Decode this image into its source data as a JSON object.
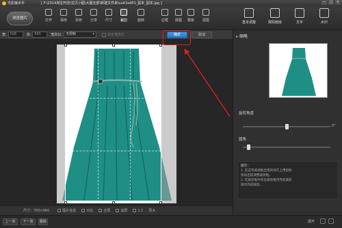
{
  "title": {
    "app_name": "光影魔术手",
    "document": "[ F:\\2014淘宝开店\\宝贝小图\\大图全部\\新建文件夹\\suit1ed01_副本_副本.jpg ]",
    "window_controls": [
      "—",
      "□",
      "×"
    ]
  },
  "toolbar": {
    "open_label": "浏览图片",
    "tools": [
      {
        "label": "打开",
        "icon": "folder-icon"
      },
      {
        "label": "保存",
        "icon": "save-icon"
      },
      {
        "label": "另存",
        "icon": "save-as-icon"
      },
      {
        "label": "分享",
        "icon": "share-icon"
      },
      {
        "label": "尺寸",
        "icon": "resize-icon"
      },
      {
        "label": "裁剪",
        "icon": "crop-icon",
        "active": true
      },
      {
        "label": "旋转",
        "icon": "rotate-icon"
      },
      {
        "label": "边框",
        "icon": "frame-icon"
      },
      {
        "label": "拼图",
        "icon": "collage-icon"
      },
      {
        "label": "模板",
        "icon": "template-icon"
      },
      {
        "label": "抠图",
        "icon": "cutout-icon"
      }
    ],
    "big_tools": [
      {
        "label": "基本调整",
        "icon": "adjust-icon"
      },
      {
        "label": "数码暗房",
        "icon": "camera-icon"
      },
      {
        "label": "文字",
        "icon": "text-icon"
      },
      {
        "label": "水印",
        "icon": "watermark-icon"
      }
    ]
  },
  "cropbar": {
    "width_label": "宽:",
    "width_value": "508",
    "height_label": "高:",
    "height_value": "895",
    "ratio_label": "宽高比:",
    "ratio_value": "无限制",
    "lock_label": "锁定宽高比",
    "ok_label": "确定",
    "cancel_label": "取消"
  },
  "canvas": {
    "dimension_text": "尺寸：700×960",
    "status_items": [
      "图片信息",
      "对比",
      "全屏",
      "适屏",
      "1:1",
      "原大"
    ]
  },
  "right_panel": {
    "preview_header": "缩略",
    "rotate_label": "旋转角度",
    "rotate_value": "0°",
    "rotate_level": 0.5,
    "corner_label": "圆角",
    "corner_level": 0.05,
    "tips_title": "提示：",
    "tips_lines": [
      "1. 在这有裁剪框出现的地方上用鼠标",
      "   拖动出现调整裁剪框。",
      "2. 在裁剪框中双击裁剪框内完成裁剪",
      "   操作完成裁剪。"
    ]
  },
  "bottom": {
    "prev_label": "上一张",
    "next_label": "下一张",
    "third_label": "删除",
    "zoom_text": "展开"
  },
  "colors": {
    "dress": "#1f8f86",
    "dress_dark": "#156b63",
    "accent_blue": "#2a6fc0",
    "annotation_red": "#e02020"
  }
}
